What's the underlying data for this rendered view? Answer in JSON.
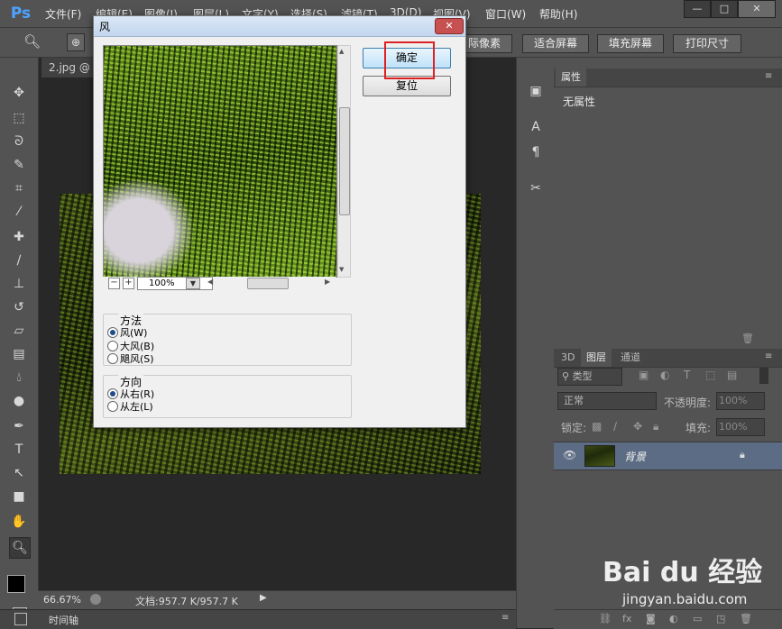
{
  "app": {
    "logo": "Ps"
  },
  "menu": [
    "文件(F)",
    "编辑(E)",
    "图像(I)",
    "图层(L)",
    "文字(Y)",
    "选择(S)",
    "滤镜(T)",
    "3D(D)",
    "视图(V)",
    "窗口(W)",
    "帮助(H)"
  ],
  "window_controls": {
    "minimize": "—",
    "maximize": "□",
    "close": "✕"
  },
  "options_bar": {
    "buttons": [
      "际像素",
      "适合屏幕",
      "填充屏幕",
      "打印尺寸"
    ]
  },
  "document": {
    "tab": "2.jpg @"
  },
  "status": {
    "zoom": "66.67%",
    "doc_info": "文档:957.7 K/957.7 K"
  },
  "timeline": {
    "label": "时间轴"
  },
  "dialog": {
    "title": "风",
    "close": "✕",
    "ok": "确定",
    "reset": "复位",
    "zoom_value": "100%",
    "zoom_minus": "−",
    "zoom_plus": "+",
    "method": {
      "label": "方法",
      "options": [
        "风(W)",
        "大风(B)",
        "飓风(S)"
      ],
      "selected": 0
    },
    "direction": {
      "label": "方向",
      "options": [
        "从右(R)",
        "从左(L)"
      ],
      "selected": 0
    }
  },
  "properties_panel": {
    "tab": "属性",
    "content": "无属性"
  },
  "layers_panel": {
    "tabs": [
      "3D",
      "图层",
      "通道"
    ],
    "filter_kind": "类型",
    "blend_mode": "正常",
    "opacity_label": "不透明度:",
    "opacity_value": "100%",
    "lock_label": "锁定:",
    "fill_label": "填充:",
    "fill_value": "100%",
    "layers": [
      {
        "name": "背景",
        "visible": true,
        "locked": true
      }
    ]
  },
  "watermark": {
    "brand": "Bai du 经验",
    "url": "jingyan.baidu.com"
  }
}
